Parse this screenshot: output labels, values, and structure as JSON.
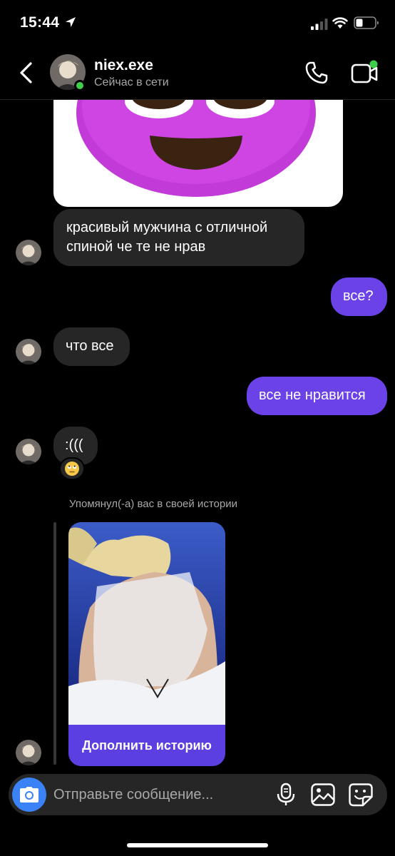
{
  "status_bar": {
    "time": "15:44",
    "icons": [
      "location-arrow-icon",
      "signal-icon",
      "wifi-icon",
      "battery-icon"
    ]
  },
  "header": {
    "username": "niex.exe",
    "presence": "Сейчас в сети",
    "online": true,
    "icons": [
      "back-icon",
      "phone-icon",
      "video-icon"
    ]
  },
  "messages": [
    {
      "direction": "in",
      "text": "красивый мужчина с отличной спиной че те не нрав"
    },
    {
      "direction": "out",
      "text": "все?"
    },
    {
      "direction": "in",
      "text": "что все"
    },
    {
      "direction": "out",
      "text": "все не нравится"
    },
    {
      "direction": "in",
      "text": ":(((",
      "reaction": "🙄"
    }
  ],
  "story_mention": {
    "note": "Упомянул(-а) вас в своей истории",
    "button": "Дополнить историю"
  },
  "composer": {
    "placeholder": "Отправьте сообщение..."
  },
  "colors": {
    "background": "#000000",
    "incoming_bubble": "#262626",
    "outgoing_bubble": "#6a42e8",
    "story_button": "#5b3fe0",
    "camera_button": "#3b82f6",
    "online": "#3ecf4c",
    "sticker_face": "#c23ad8"
  }
}
